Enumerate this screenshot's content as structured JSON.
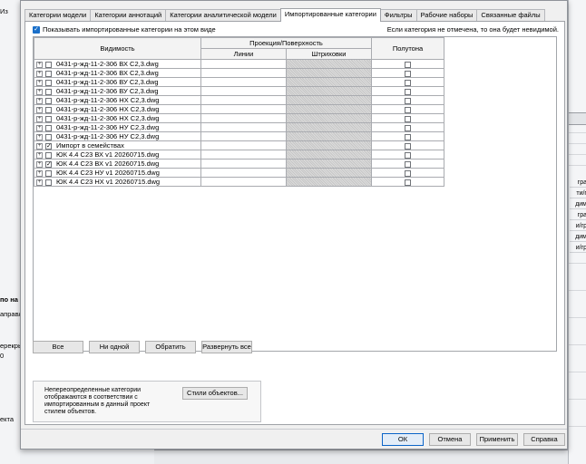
{
  "background": {
    "top_fragment": "Из",
    "left_texts": [
      {
        "text": "по на",
        "bold": true
      },
      {
        "text": "аправл",
        "bold": false
      },
      {
        "text": "ерекры",
        "bold": false
      },
      {
        "text": "0",
        "bold": false
      },
      {
        "text": "екта",
        "bold": false
      }
    ],
    "right_texts": [
      "гра",
      "ти/г",
      "дим",
      "гра",
      "и/гр",
      "дим",
      "и/гр"
    ]
  },
  "tabs": [
    {
      "label": "Категории модели",
      "active": false
    },
    {
      "label": "Категории аннотаций",
      "active": false
    },
    {
      "label": "Категории аналитической модели",
      "active": false
    },
    {
      "label": "Импортированные категории",
      "active": true
    },
    {
      "label": "Фильтры",
      "active": false
    },
    {
      "label": "Рабочие наборы",
      "active": false
    },
    {
      "label": "Связанные файлы",
      "active": false
    }
  ],
  "show_imported": {
    "label": "Показывать импортированные категории на этом виде",
    "checked": true
  },
  "hint": "Если категория не отмечена, то она будет невидимой.",
  "table": {
    "headers": {
      "visibility": "Видимость",
      "projection": "Проекция/Поверхность",
      "lines": "Линии",
      "hatches": "Штриховки",
      "halftone": "Полутона"
    },
    "rows": [
      {
        "name": "0431-р-жд-11-2-306 ВХ С2,3.dwg",
        "checked": false
      },
      {
        "name": "0431-р-жд-11-2-306 ВХ С2,3.dwg",
        "checked": false
      },
      {
        "name": "0431-р-жд-11-2-306 ВУ С2,3.dwg",
        "checked": false
      },
      {
        "name": "0431-р-жд-11-2-306 ВУ С2,3.dwg",
        "checked": false
      },
      {
        "name": "0431-р-жд-11-2-306 НХ С2,3.dwg",
        "checked": false
      },
      {
        "name": "0431-р-жд-11-2-306 НХ С2,3.dwg",
        "checked": false
      },
      {
        "name": "0431-р-жд-11-2-306 НХ С2,3.dwg",
        "checked": false
      },
      {
        "name": "0431-р-жд-11-2-306 НУ С2,3.dwg",
        "checked": false
      },
      {
        "name": "0431-р-жд-11-2-306 НУ С2,3.dwg",
        "checked": false
      },
      {
        "name": "Импорт в семействах",
        "checked": true
      },
      {
        "name": "ЮК 4.4 С23 ВХ v1 20260715.dwg",
        "checked": false
      },
      {
        "name": "ЮК 4.4 С23 ВХ v1 20260715.dwg",
        "checked": true
      },
      {
        "name": "ЮК 4.4 С23 НУ v1 20260715.dwg",
        "checked": false
      },
      {
        "name": "ЮК 4.4 С23 НХ v1 20260715.dwg",
        "checked": false
      }
    ]
  },
  "buttons": {
    "all": "Все",
    "none": "Ни одной",
    "invert": "Обратить",
    "expand_all": "Развернуть все",
    "object_styles": "Стили объектов...",
    "ok": "ОК",
    "cancel": "Отмена",
    "apply": "Применить",
    "help": "Справка"
  },
  "note": "Непереопределенные категории отображаются в соответствии с импортированным в данный проект стилем объектов."
}
